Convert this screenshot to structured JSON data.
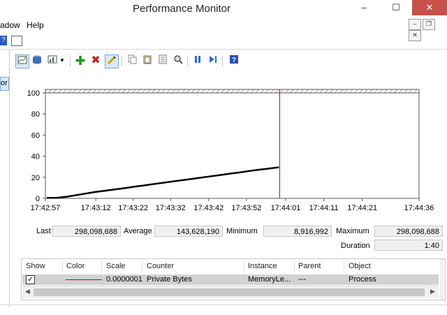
{
  "window": {
    "title": "Performance Monitor",
    "controls": {
      "minimize": "–",
      "maximize": "☐",
      "close": "✕"
    }
  },
  "menu": {
    "items": [
      "adow",
      "Help"
    ]
  },
  "left_panel": {
    "selected_fragment": "or"
  },
  "chart_data": {
    "type": "line",
    "x_ticks": [
      "17:42:57",
      "17:43:12",
      "17:43:22",
      "17:43:32",
      "17:43:42",
      "17:43:52",
      "17:44:01",
      "17:44:11",
      "17:44:21",
      "17:44:36"
    ],
    "y_ticks": [
      "0",
      "20",
      "40",
      "60",
      "80",
      "100"
    ],
    "ylim": [
      0,
      100
    ],
    "series": [
      {
        "color": "#000000",
        "values": [
          0.5,
          0.5,
          1.5,
          3.0,
          4.5,
          6.0,
          7.2,
          8.4,
          9.6,
          11.0,
          12.2,
          13.5,
          14.7,
          16.0,
          17.2,
          18.5,
          19.7,
          21.0,
          22.2,
          23.5,
          24.7,
          26.0,
          27.2,
          28.3,
          29.5
        ]
      }
    ],
    "cursor_line_color": "#cc0000"
  },
  "stats": {
    "last_label": "Last",
    "last": "298,098,688",
    "average_label": "Average",
    "average": "143,628,190",
    "minimum_label": "Minimum",
    "minimum": "8,916,992",
    "maximum_label": "Maximum",
    "maximum": "298,098,688",
    "duration_label": "Duration",
    "duration": "1:40"
  },
  "counter_table": {
    "headers": [
      "Show",
      "Color",
      "Scale",
      "Counter",
      "Instance",
      "Parent",
      "Object"
    ],
    "rows": [
      {
        "show": "✓",
        "color": "#cc0000",
        "scale": "0.0000001",
        "counter": "Private Bytes",
        "instance": "MemoryLe...",
        "parent": "---",
        "object": "Process"
      }
    ]
  }
}
